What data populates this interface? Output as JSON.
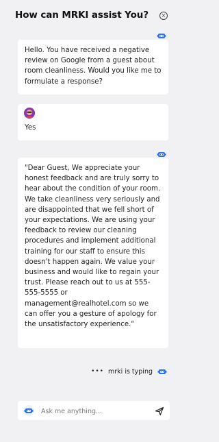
{
  "header": {
    "title": "How can MRKI assist You?"
  },
  "messages": [
    {
      "from": "bot",
      "text": "Hello. You have received a negative review on Google from a guest about room cleanliness. Would you like me to formulate a response?"
    },
    {
      "from": "user",
      "text": "Yes"
    },
    {
      "from": "bot",
      "text": "\"Dear Guest, We appreciate your honest feedback and are truly sorry to hear about the condition of your room. We take cleanliness very seriously and are disappointed that we fell short of your expectations. We are using your feedback to review our cleaning procedures and implement additional training for our staff to ensure this doesn't happen again. We value your business and would like to regain your trust. Please reach out to us at 555-555-5555 or management@realhotel.com so we can offer you a gesture of apology for the unsatisfactory experience.\""
    }
  ],
  "typing_indicator": {
    "text": "mrki is typing"
  },
  "composer": {
    "placeholder": "Ask me anything..."
  },
  "icons": {
    "bot": "robot-icon",
    "close": "close-icon",
    "send": "send-icon"
  },
  "colors": {
    "background": "#f1f1f4",
    "bubble": "#ffffff",
    "accent": "#2f6fe8"
  }
}
